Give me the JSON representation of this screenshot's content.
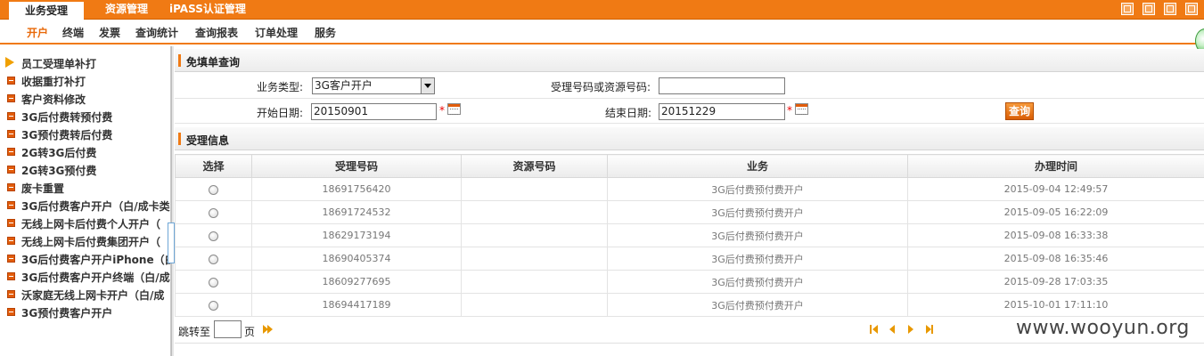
{
  "top_tabs": [
    {
      "label": "业务受理",
      "active": true
    },
    {
      "label": "资源管理",
      "active": false
    },
    {
      "label": "iPASS认证管理",
      "active": false
    }
  ],
  "sub_nav": [
    {
      "label": "开户",
      "active": true
    },
    {
      "label": "终端",
      "active": false
    },
    {
      "label": "发票",
      "active": false
    },
    {
      "label": "查询统计",
      "active": false
    },
    {
      "label": "查询报表",
      "active": false
    },
    {
      "label": "订单处理",
      "active": false
    },
    {
      "label": "服务",
      "active": false
    }
  ],
  "sidebar": {
    "items": [
      {
        "label": "员工受理单补打",
        "icon": "arrow-right-icon",
        "current": true
      },
      {
        "label": "收据重打补打",
        "icon": "minus-square-icon"
      },
      {
        "label": "客户资料修改",
        "icon": "minus-square-icon"
      },
      {
        "label": "3G后付费转预付费",
        "icon": "minus-square-icon"
      },
      {
        "label": "3G预付费转后付费",
        "icon": "minus-square-icon"
      },
      {
        "label": "2G转3G后付费",
        "icon": "minus-square-icon"
      },
      {
        "label": "2G转3G预付费",
        "icon": "minus-square-icon"
      },
      {
        "label": "废卡重置",
        "icon": "minus-square-icon"
      },
      {
        "label": "3G后付费客户开户（白/成卡类",
        "icon": "minus-square-icon"
      },
      {
        "label": "无线上网卡后付费个人开户（",
        "icon": "minus-square-icon"
      },
      {
        "label": "无线上网卡后付费集团开户（",
        "icon": "minus-square-icon"
      },
      {
        "label": "3G后付费客户开户iPhone（白",
        "icon": "minus-square-icon"
      },
      {
        "label": "3G后付费客户开户终端（白/成",
        "icon": "minus-square-icon"
      },
      {
        "label": "沃家庭无线上网卡开户（白/成",
        "icon": "minus-square-icon"
      },
      {
        "label": "3G预付费客户开户",
        "icon": "minus-square-icon"
      }
    ]
  },
  "query_section": {
    "title": "免填单查询",
    "business_type_label": "业务类型:",
    "business_type_value": "3G客户开户",
    "number_label": "受理号码或资源号码:",
    "number_value": "",
    "start_date_label": "开始日期:",
    "start_date_value": "20150901",
    "end_date_label": "结束日期:",
    "end_date_value": "20151229",
    "required_mark": "*",
    "query_button": "查询"
  },
  "info_section": {
    "title": "受理信息"
  },
  "table": {
    "columns": [
      "选择",
      "受理号码",
      "资源号码",
      "业务",
      "办理时间"
    ],
    "rows": [
      {
        "number": "18691756420",
        "resource": "",
        "business": "3G后付费预付费开户",
        "time": "2015-09-04 12:49:57"
      },
      {
        "number": "18691724532",
        "resource": "",
        "business": "3G后付费预付费开户",
        "time": "2015-09-05 16:22:09"
      },
      {
        "number": "18629173194",
        "resource": "",
        "business": "3G后付费预付费开户",
        "time": "2015-09-08 16:33:38"
      },
      {
        "number": "18690405374",
        "resource": "",
        "business": "3G后付费预付费开户",
        "time": "2015-09-08 16:35:46"
      },
      {
        "number": "18609277695",
        "resource": "",
        "business": "3G后付费预付费开户",
        "time": "2015-09-28 17:03:35"
      },
      {
        "number": "18694417189",
        "resource": "",
        "business": "3G后付费预付费开户",
        "time": "2015-10-01 17:11:10"
      }
    ]
  },
  "pager": {
    "jump_label": "跳转至",
    "page_unit": "页",
    "page_value": ""
  },
  "watermark": "www.wooyun.org",
  "colors": {
    "accent": "#f07a14",
    "accent_dark": "#e25c0a"
  }
}
